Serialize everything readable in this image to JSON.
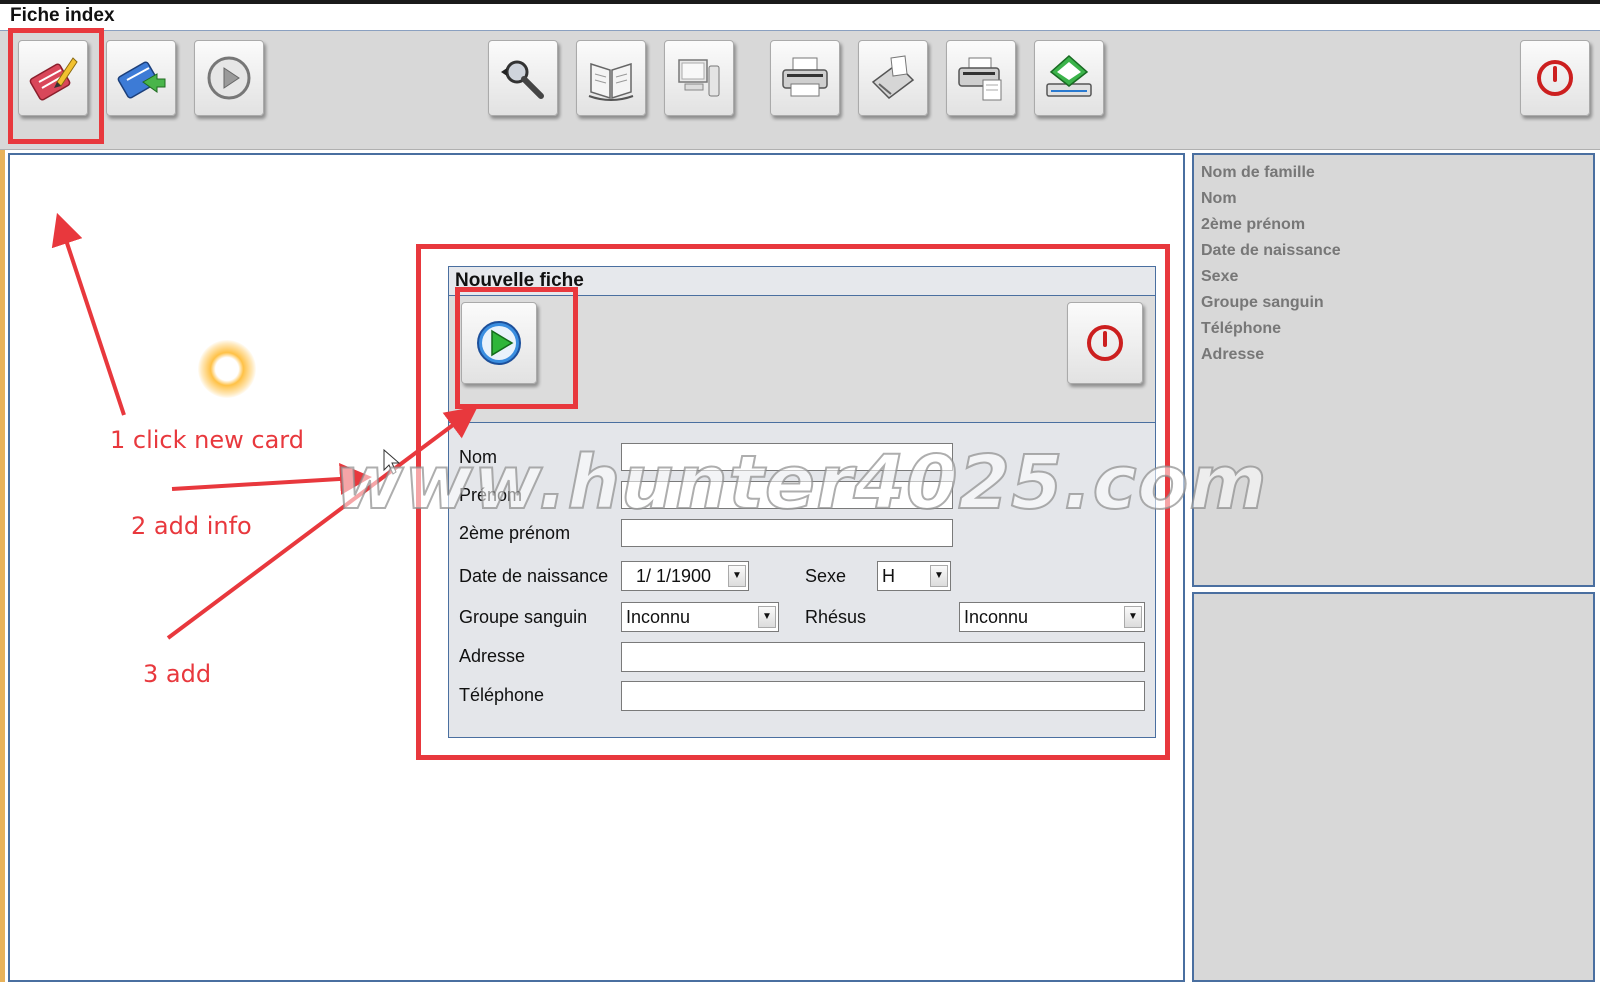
{
  "window": {
    "title": "Fiche index"
  },
  "toolbar": {
    "buttons": [
      {
        "id": "new-card",
        "icon": "pencil-card-icon"
      },
      {
        "id": "edit-card",
        "icon": "card-arrow-icon"
      },
      {
        "id": "play",
        "icon": "play-grey-icon"
      },
      {
        "id": "search",
        "icon": "magnifier-icon"
      },
      {
        "id": "book",
        "icon": "open-book-icon"
      },
      {
        "id": "computer",
        "icon": "computer-icon"
      },
      {
        "id": "print",
        "icon": "printer-icon"
      },
      {
        "id": "fax",
        "icon": "fax-icon"
      },
      {
        "id": "print-preview",
        "icon": "print-preview-icon"
      },
      {
        "id": "scanner",
        "icon": "scanner-icon"
      },
      {
        "id": "power",
        "icon": "power-icon"
      }
    ]
  },
  "side_panel": {
    "fields": [
      "Nom de famille",
      "Nom",
      "2ème prénom",
      "Date de naissance",
      "Sexe",
      "Groupe sanguin",
      "Téléphone",
      "Adresse"
    ]
  },
  "dialog": {
    "title": "Nouvelle fiche",
    "add_icon": "play-green-icon",
    "close_icon": "power-icon",
    "form": {
      "nom_label": "Nom",
      "nom_value": "",
      "prenom_label": "Prénom",
      "prenom_value": "",
      "deuxieme_prenom_label": "2ème prénom",
      "deuxieme_prenom_value": "",
      "date_label": "Date de naissance",
      "date_value": "1/ 1/1900",
      "sexe_label": "Sexe",
      "sexe_value": "H",
      "groupe_label": "Groupe sanguin",
      "groupe_value": "Inconnu",
      "rhesus_label": "Rhésus",
      "rhesus_value": "Inconnu",
      "adresse_label": "Adresse",
      "adresse_value": "",
      "telephone_label": "Téléphone",
      "telephone_value": ""
    }
  },
  "annotations": {
    "step1": "1 click new card",
    "step2": "2 add info",
    "step3": "3 add",
    "color": "#e8383d"
  },
  "watermark": "www.hunter4025.com"
}
